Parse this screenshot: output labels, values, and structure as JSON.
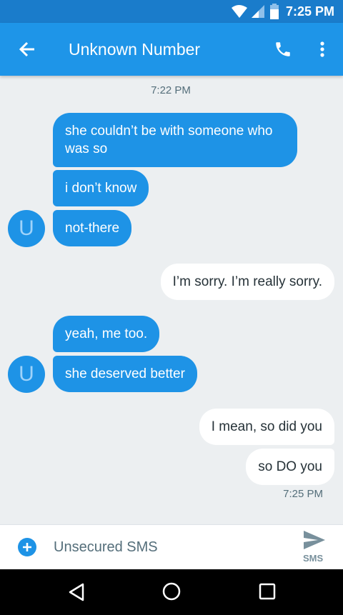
{
  "status_bar": {
    "time": "7:25 PM"
  },
  "app_bar": {
    "title": "Unknown Number"
  },
  "messages": [
    {
      "type": "timestamp",
      "text": "7:22 PM"
    },
    {
      "type": "incoming",
      "text": "she couldn’t be with someone who was so"
    },
    {
      "type": "incoming",
      "text": "i don’t know"
    },
    {
      "type": "incoming",
      "text": "not-there"
    },
    {
      "type": "outgoing",
      "text": "I’m sorry. I’m really sorry."
    },
    {
      "type": "incoming",
      "text": "yeah, me too."
    },
    {
      "type": "incoming",
      "text": "she deserved better"
    },
    {
      "type": "outgoing",
      "text": "I mean, so did you"
    },
    {
      "type": "outgoing",
      "text": "so DO you"
    },
    {
      "type": "timestamp",
      "text": "7:25 PM"
    }
  ],
  "avatar_letter": "U",
  "compose": {
    "placeholder": "Unsecured SMS",
    "send_label": "SMS"
  },
  "colors": {
    "accent": "#1e95e8",
    "status": "#1a7ccb",
    "background": "#eceff1"
  }
}
